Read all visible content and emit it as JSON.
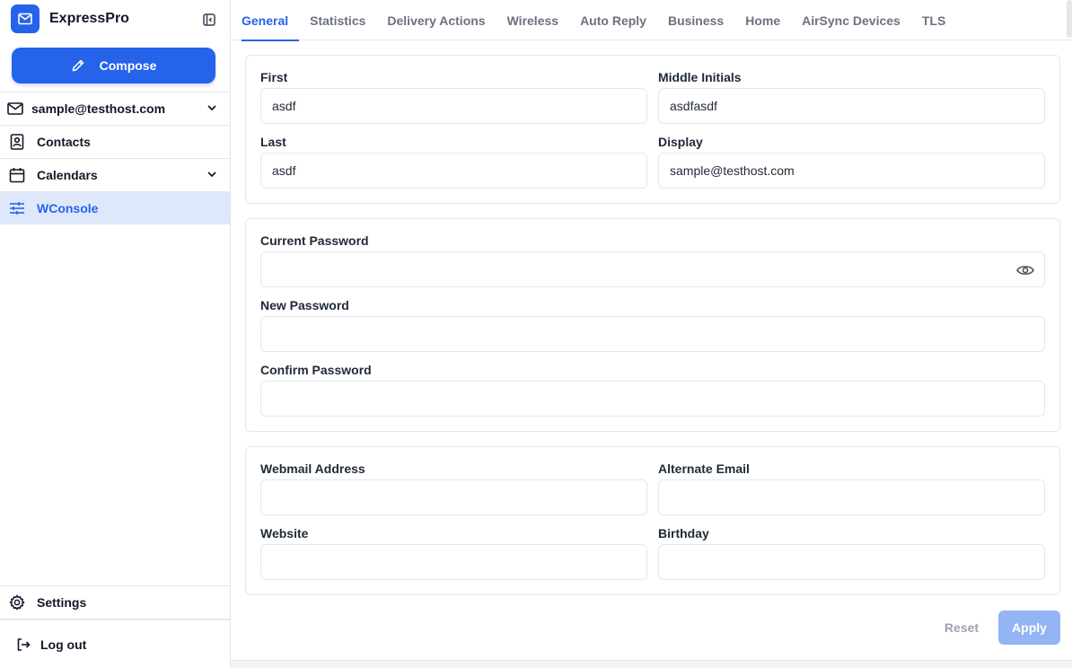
{
  "app": {
    "name": "ExpressPro"
  },
  "sidebar": {
    "compose_label": "Compose",
    "account": "sample@testhost.com",
    "items": [
      {
        "label": "Contacts"
      },
      {
        "label": "Calendars"
      },
      {
        "label": "WConsole"
      }
    ],
    "settings_label": "Settings",
    "logout_label": "Log out"
  },
  "tabs": [
    "General",
    "Statistics",
    "Delivery Actions",
    "Wireless",
    "Auto Reply",
    "Business",
    "Home",
    "AirSync Devices",
    "TLS"
  ],
  "active_tab": "General",
  "names": {
    "first_label": "First",
    "first_value": "asdf",
    "middle_label": "Middle Initials",
    "middle_value": "asdfasdf",
    "last_label": "Last",
    "last_value": "asdf",
    "display_label": "Display",
    "display_value": "sample@testhost.com"
  },
  "passwords": {
    "current_label": "Current Password",
    "new_label": "New Password",
    "confirm_label": "Confirm Password"
  },
  "contact": {
    "webmail_label": "Webmail Address",
    "alternate_label": "Alternate Email",
    "website_label": "Website",
    "birthday_label": "Birthday"
  },
  "actions": {
    "reset_label": "Reset",
    "apply_label": "Apply"
  },
  "colors": {
    "accent": "#2563eb",
    "active_bg": "#dfe8fb",
    "apply_disabled": "#93b4f5"
  }
}
